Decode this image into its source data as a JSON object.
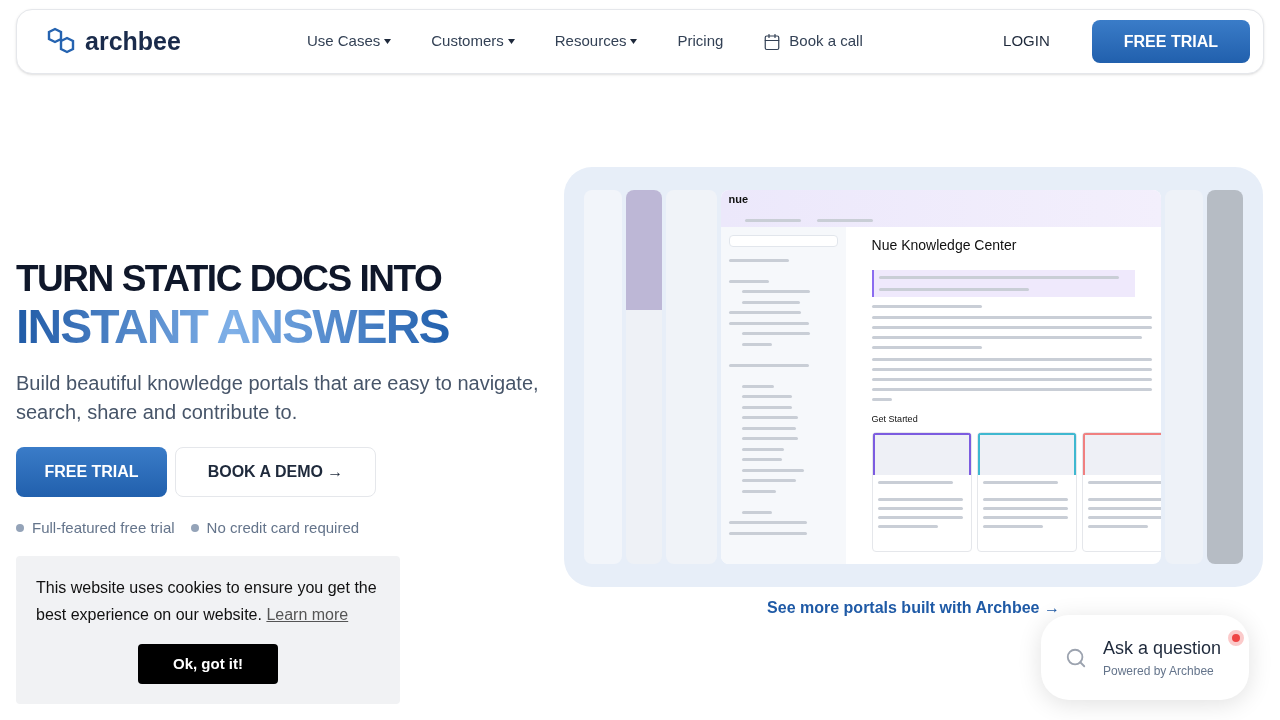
{
  "nav": {
    "logo": "archbee",
    "menu": [
      {
        "label": "Use Cases",
        "kind": "dropdown"
      },
      {
        "label": "Customers",
        "kind": "dropdown"
      },
      {
        "label": "Resources",
        "kind": "dropdown"
      },
      {
        "label": "Pricing",
        "kind": "link"
      },
      {
        "label": "Book a call",
        "kind": "calendar"
      }
    ],
    "login": "LOGIN",
    "cta": "FREE TRIAL"
  },
  "hero": {
    "heading_line1": "TURN STATIC DOCS INTO",
    "heading_line2": "INSTANT ANSWERS",
    "subtitle": "Build beautiful knowledge portals that are easy to navigate, search, share and contribute to.",
    "primary_button": "FREE TRIAL",
    "secondary_button": "BOOK A DEMO →",
    "bullets": [
      "Full-featured free trial",
      "No credit card required"
    ]
  },
  "showcase": {
    "portal": {
      "brand": "nue",
      "page": {
        "title": "Nue Knowledge Center",
        "section_heading": "Get Started",
        "cards": [
          {
            "color": "#7c5ce0"
          },
          {
            "color": "#3fb8d0"
          },
          {
            "color": "#f08080"
          }
        ]
      }
    },
    "link": "See more portals built with Archbee →"
  },
  "cookie": {
    "text": "This website uses cookies to ensure you get the best experience on our website.",
    "link": "Learn more",
    "button": "Ok, got it!"
  },
  "assistant": {
    "title": "Ask a question",
    "subtitle": "Powered by Archbee",
    "notification": true
  }
}
